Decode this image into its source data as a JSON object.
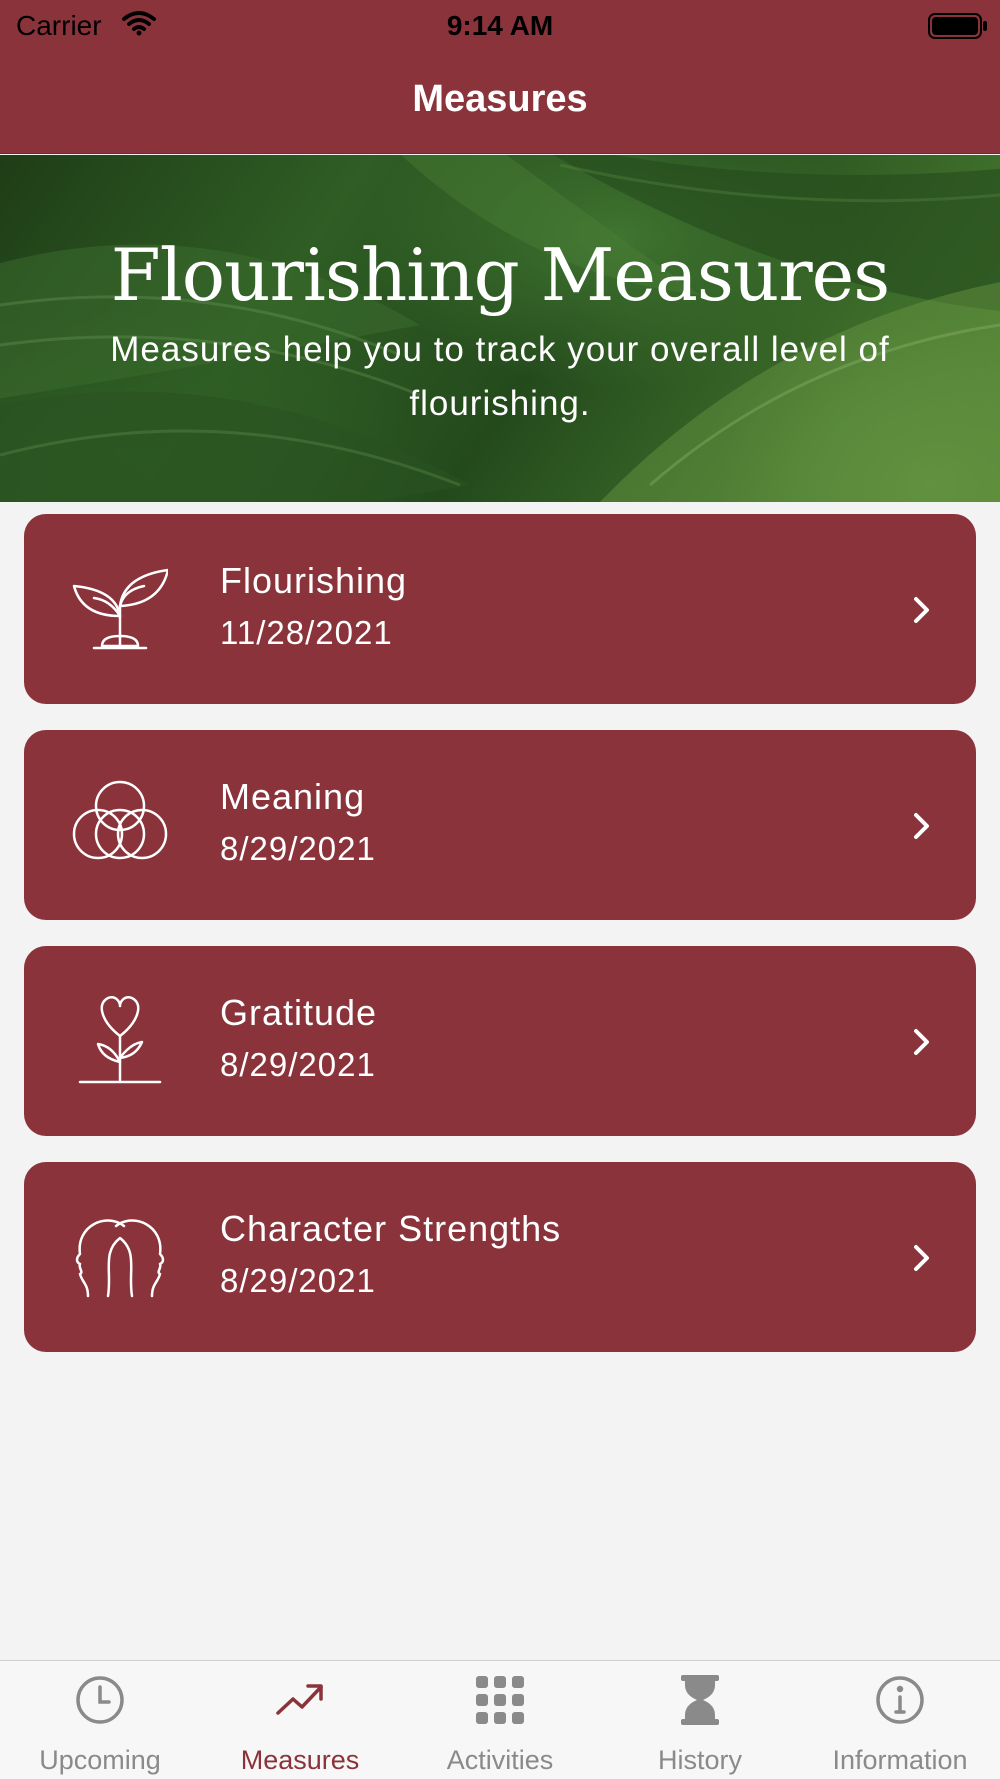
{
  "status_bar": {
    "carrier": "Carrier",
    "time": "9:14 AM"
  },
  "nav": {
    "title": "Measures"
  },
  "hero": {
    "title": "Flourishing Measures",
    "subtitle": "Measures help you to track your overall level of flourishing."
  },
  "measures": [
    {
      "name": "Flourishing",
      "date": "11/28/2021",
      "icon": "sprout-icon"
    },
    {
      "name": "Meaning",
      "date": "8/29/2021",
      "icon": "overlapping-circles-icon"
    },
    {
      "name": "Gratitude",
      "date": "8/29/2021",
      "icon": "heart-flower-icon"
    },
    {
      "name": "Character Strengths",
      "date": "8/29/2021",
      "icon": "two-heads-icon"
    }
  ],
  "tabs": [
    {
      "label": "Upcoming",
      "icon": "clock-icon",
      "active": false
    },
    {
      "label": "Measures",
      "icon": "trending-up-icon",
      "active": true
    },
    {
      "label": "Activities",
      "icon": "grid-icon",
      "active": false
    },
    {
      "label": "History",
      "icon": "hourglass-icon",
      "active": false
    },
    {
      "label": "Information",
      "icon": "info-icon",
      "active": false
    }
  ],
  "colors": {
    "accent": "#8a333b",
    "background": "#f3f3f3",
    "tab_inactive": "#8a8a8a"
  }
}
